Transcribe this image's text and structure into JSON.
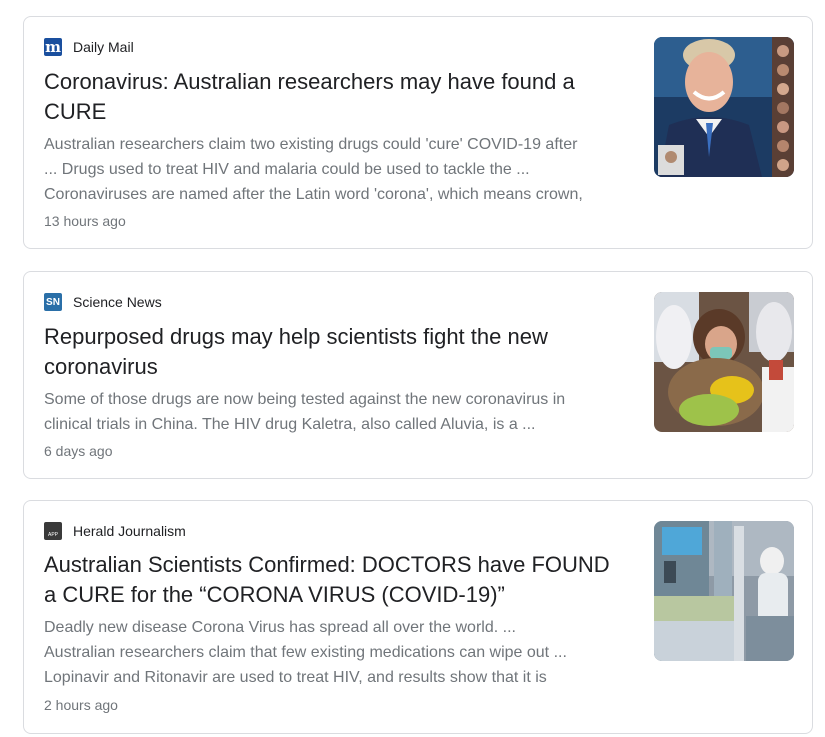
{
  "results": [
    {
      "source": "Daily Mail",
      "source_icon": "daily-mail-logo-icon",
      "logo_text": "m",
      "logo_color": "#1a4f9e",
      "headline": "Coronavirus: Australian researchers may have found a CURE",
      "snippet": "Australian researchers claim two existing drugs could 'cure' COVID-19 after\n... Drugs used to treat HIV and malaria could be used to tackle the ...\nCoronaviruses are named after the Latin word 'corona', which means crown,",
      "time": "13 hours ago",
      "thumbnail": "smiling-man-in-suit-photo"
    },
    {
      "source": "Science News",
      "source_icon": "science-news-logo-icon",
      "logo_text": "SN",
      "logo_color": "#2a6fa8",
      "headline": "Repurposed drugs may help scientists fight the new coronavirus",
      "snippet": "Some of those drugs are now being tested against the new coronavirus in\nclinical trials in China. The HIV drug Kaletra, also called Aluvia, is a ...",
      "time": "6 days ago",
      "thumbnail": "masked-patient-crowd-photo"
    },
    {
      "source": "Herald Journalism",
      "source_icon": "herald-journalism-logo-icon",
      "logo_text": "APP",
      "logo_color": "#3a3a3a",
      "headline": "Australian Scientists Confirmed: DOCTORS have FOUND a CURE for the “CORONA VIRUS (COVID-19)”",
      "snippet": "Deadly new disease Corona Virus has spread all over the world. ...\nAustralian researchers claim that few existing medications can wipe out ...\nLopinavir and Ritonavir are used to treat HIV, and results show that it is",
      "time": "2 hours ago",
      "thumbnail": "hospital-ward-photo"
    }
  ]
}
